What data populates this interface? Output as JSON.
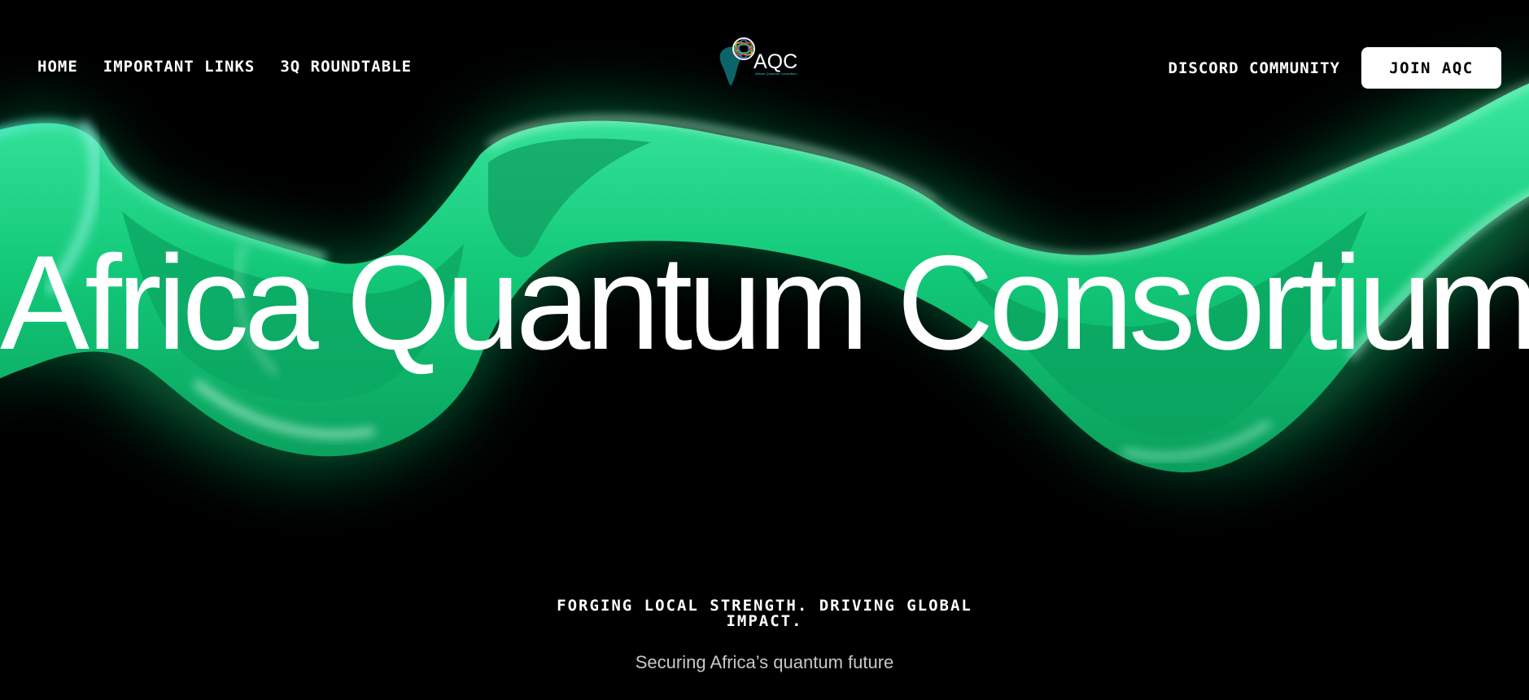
{
  "nav": {
    "left_links": [
      {
        "label": "HOME"
      },
      {
        "label": "IMPORTANT LINKS"
      },
      {
        "label": "3Q ROUNDTABLE"
      }
    ],
    "logo": {
      "text": "AQC",
      "subtext": "African Quantum Consortium"
    },
    "discord_label": "DISCORD COMMUNITY",
    "join_label": "JOIN AQC"
  },
  "hero": {
    "title": "Africa Quantum Consortium",
    "tagline": "FORGING LOCAL STRENGTH. DRIVING GLOBAL IMPACT.",
    "subtitle": "Securing Africa’s quantum future"
  },
  "colors": {
    "background": "#000000",
    "accent_green": "#17d07f",
    "button_bg": "#ffffff",
    "text": "#ffffff"
  }
}
